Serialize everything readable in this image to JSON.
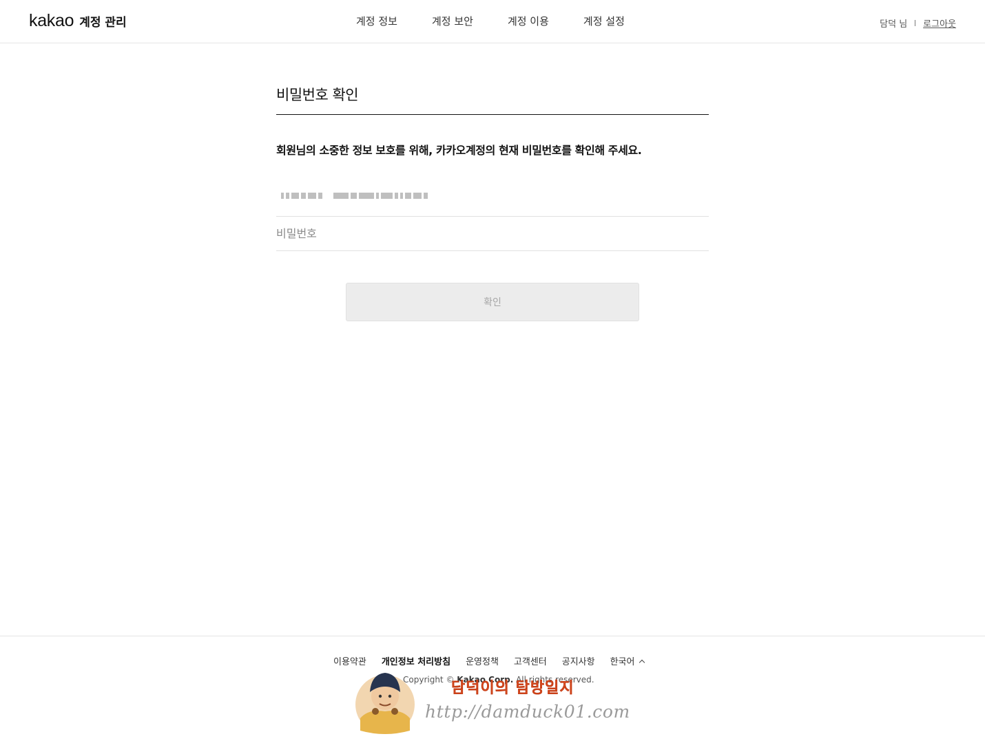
{
  "header": {
    "logo_word": "kakao",
    "logo_sub": "계정 관리",
    "nav": [
      "계정 정보",
      "계정 보안",
      "계정 이용",
      "계정 설정"
    ],
    "user_name": "담덕 님",
    "logout_label": "로그아웃"
  },
  "main": {
    "title": "비밀번호 확인",
    "description": "회원님의 소중한 정보 보호를 위해, 카카오계정의 현재 비밀번호를 확인해 주세요.",
    "password_placeholder": "비밀번호",
    "confirm_label": "확인"
  },
  "footer": {
    "links": [
      "이용약관",
      "개인정보 처리방침",
      "운영정책",
      "고객센터",
      "공지사항"
    ],
    "language": "한국어",
    "copyright_prefix": "Copyright © ",
    "copyright_company": "Kakao Corp.",
    "copyright_suffix": " All rights reserved."
  },
  "watermark": {
    "title": "담덕이의 탐방일지",
    "url": "http://damduck01.com"
  },
  "colors": {
    "button_disabled_bg": "#ececec",
    "button_disabled_text": "#a6a6a6",
    "watermark_title": "#e8572a"
  }
}
